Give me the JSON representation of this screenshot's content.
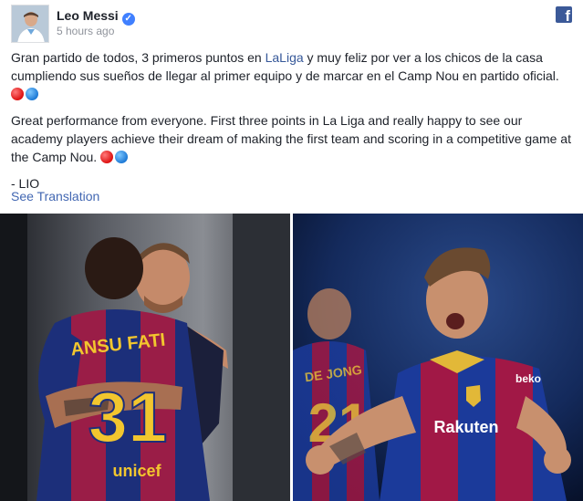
{
  "post": {
    "author": "Leo Messi",
    "verified_icon": "check-icon",
    "timestamp": "5 hours ago",
    "platform_icon": "facebook-icon",
    "text_es_before_link": "Gran partido de todos, 3 primeros puntos en ",
    "text_es_link": "LaLiga",
    "text_es_after_link": " y muy feliz por ver a los chicos de la casa cumpliendo sus sueños de llegar al primer equipo y de marcar en el Camp Nou en partido oficial.",
    "text_en": "Great performance from everyone. First three points in La Liga and really happy to see our academy players achieve their dream of making the first team and scoring in a competitive game at the Camp Nou.",
    "signature": "- LIO",
    "see_translation": "See Translation"
  },
  "photos": {
    "left": {
      "jersey_name": "ANSU FATI",
      "jersey_number": "31",
      "sponsor": "unicef"
    },
    "right": {
      "jersey_name": "DE JONG",
      "jersey_number": "21",
      "sponsor": "Rakuten",
      "brand": "beko"
    }
  },
  "colors": {
    "link": "#365899",
    "accent": "#4267b2",
    "barca_blue": "#0a3a8c",
    "barca_red": "#a50044"
  }
}
